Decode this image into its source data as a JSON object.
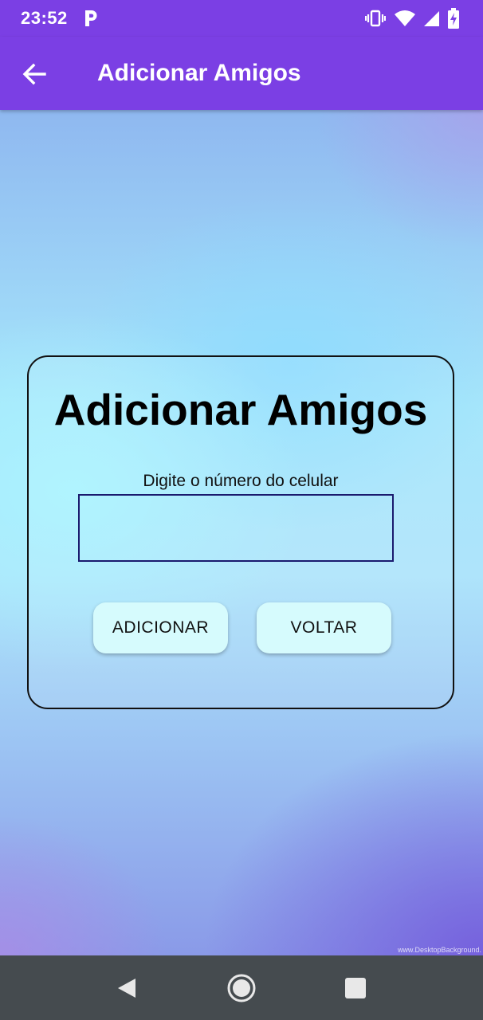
{
  "status_bar": {
    "time": "23:52",
    "notification_icon": "p-icon",
    "icons": [
      "vibrate-icon",
      "wifi-icon",
      "signal-icon",
      "battery-charging-icon"
    ]
  },
  "app_bar": {
    "back_icon": "arrow-back-icon",
    "title": "Adicionar Amigos",
    "background": "#7b3fe4"
  },
  "card": {
    "title": "Adicionar Amigos",
    "phone_label": "Digite o número do celular",
    "phone_value": "",
    "add_button": "ADICIONAR",
    "back_button": "VOLTAR",
    "button_color": "#d6fbfd"
  },
  "watermark": "www.DesktopBackground.",
  "nav_bar": {
    "icons": [
      "nav-back-icon",
      "nav-home-icon",
      "nav-recents-icon"
    ],
    "background": "#454b4f"
  }
}
